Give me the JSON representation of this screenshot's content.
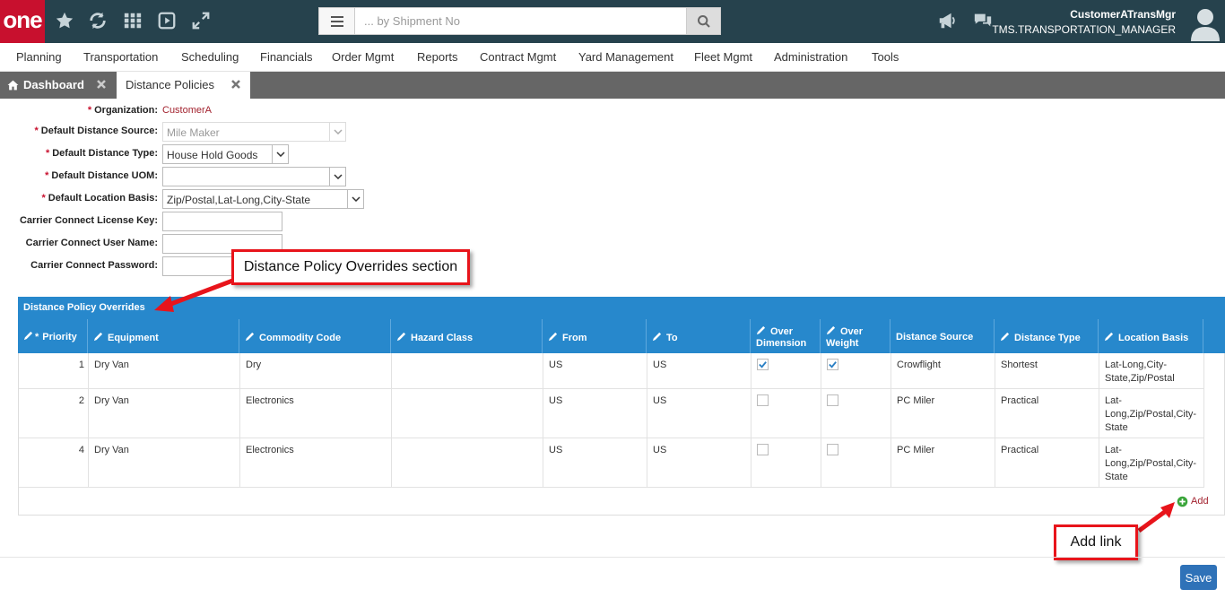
{
  "app": {
    "logo_text": "one",
    "search_placeholder": "... by Shipment No",
    "user_name": "CustomerATransMgr",
    "user_role": "TMS.TRANSPORTATION_MANAGER",
    "colors": {
      "topbar": "#26424d",
      "logo": "#c8102e",
      "grid_header": "#2788cc",
      "tabbar": "#666666",
      "save": "#2f72b8"
    }
  },
  "toolbar_icons": [
    "star-icon",
    "refresh-icon",
    "apps-grid-icon",
    "play-icon",
    "expand-icon"
  ],
  "menu": [
    "Planning",
    "Transportation",
    "Scheduling",
    "Financials",
    "Order Mgmt",
    "Reports",
    "Contract Mgmt",
    "Yard Management",
    "Fleet Mgmt",
    "Administration",
    "Tools"
  ],
  "tabs": {
    "dashboard": "Dashboard",
    "active": "Distance Policies"
  },
  "form": {
    "organization_label": "Organization:",
    "organization_value": "CustomerA",
    "distance_source_label": "Default Distance Source:",
    "distance_source_value": "Mile Maker",
    "distance_type_label": "Default Distance Type:",
    "distance_type_value": "House Hold Goods",
    "distance_uom_label": "Default Distance UOM:",
    "distance_uom_value": "",
    "location_basis_label": "Default Location Basis:",
    "location_basis_value": "Zip/Postal,Lat-Long,City-State",
    "license_key_label": "Carrier Connect License Key:",
    "user_name_label": "Carrier Connect User Name:",
    "password_label": "Carrier Connect Password:"
  },
  "callouts": {
    "section": "Distance Policy Overrides section",
    "add": "Add link"
  },
  "grid": {
    "title": "Distance Policy Overrides",
    "columns": {
      "priority": "Priority",
      "equipment": "Equipment",
      "commodity": "Commodity Code",
      "hazard": "Hazard Class",
      "from": "From",
      "to": "To",
      "over_dim_1": "Over",
      "over_dim_2": "Dimension",
      "over_wt_1": "Over",
      "over_wt_2": "Weight",
      "source": "Distance Source",
      "type": "Distance Type",
      "basis": "Location Basis"
    },
    "rows": [
      {
        "priority": "1",
        "equipment": "Dry Van",
        "commodity": "Dry",
        "hazard": "",
        "from": "US",
        "to": "US",
        "over_dimension": true,
        "over_weight": true,
        "source": "Crowflight",
        "type": "Shortest",
        "basis": "Lat-Long,City-State,Zip/Postal"
      },
      {
        "priority": "2",
        "equipment": "Dry Van",
        "commodity": "Electronics",
        "hazard": "",
        "from": "US",
        "to": "US",
        "over_dimension": false,
        "over_weight": false,
        "source": "PC Miler",
        "type": "Practical",
        "basis": "Lat-Long,Zip/Postal,City-State"
      },
      {
        "priority": "4",
        "equipment": "Dry Van",
        "commodity": "Electronics",
        "hazard": "",
        "from": "US",
        "to": "US",
        "over_dimension": false,
        "over_weight": false,
        "source": "PC Miler",
        "type": "Practical",
        "basis": "Lat-Long,Zip/Postal,City-State"
      }
    ],
    "add_label": "Add"
  },
  "save_label": "Save"
}
